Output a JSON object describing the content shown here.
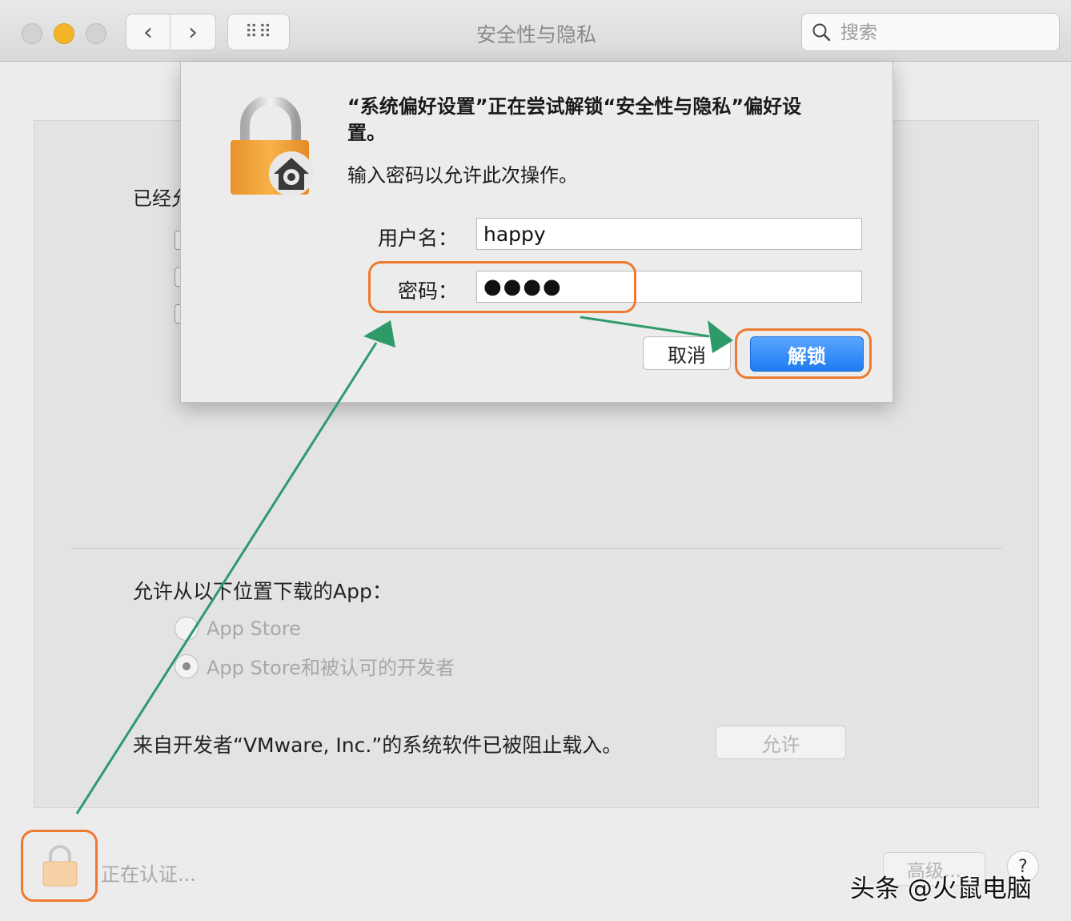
{
  "window": {
    "title": "安全性与隐私",
    "search_placeholder": "搜索",
    "nav": {
      "back_glyph": "‹",
      "forward_glyph": "›",
      "grid_glyph": "⠿⠿"
    }
  },
  "sheet": {
    "title": "“系统偏好设置”正在尝试解锁“安全性与隐私”偏好设置。",
    "prompt": "输入密码以允许此次操作。",
    "username_label": "用户名：",
    "username_value": "happy",
    "password_label": "密码：",
    "password_value": "●●●●",
    "cancel_label": "取消",
    "unlock_label": "解锁"
  },
  "panel": {
    "partial_label": "已经允",
    "download_section_label": "允许从以下位置下载的App：",
    "radio_options": [
      {
        "label": "App Store",
        "selected": false
      },
      {
        "label": "App Store和被认可的开发者",
        "selected": true
      }
    ],
    "blocked_text": "来自开发者“VMware, Inc.”的系统软件已被阻止载入。",
    "allow_label": "允许"
  },
  "footer": {
    "auth_status": "正在认证...",
    "advanced_label": "高级...",
    "help_label": "?"
  },
  "watermark": "头条 @火鼠电脑",
  "colors": {
    "annotation_orange": "#ee7a2f",
    "annotation_arrow": "#2e9a6a",
    "accent_blue": "#1f7cf1",
    "lock_body": "#f2a93b"
  },
  "icons": {
    "search": "magnifier-icon",
    "sheet_lock": "padlock-with-gear-icon",
    "footer_lock": "padlock-icon"
  }
}
